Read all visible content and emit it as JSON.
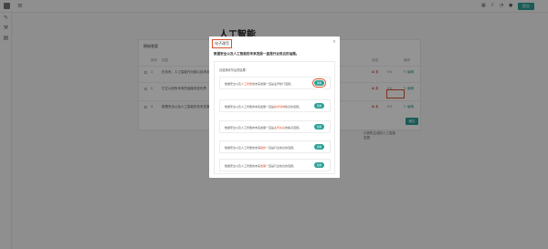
{
  "topbar": {
    "icons": [
      "grid-icon",
      "upload-icon",
      "bell-icon",
      "user-icon"
    ],
    "button_label": "提交"
  },
  "sidebar": {
    "items": [
      "edit-icon",
      "tool-icon",
      "calendar-icon"
    ]
  },
  "document": {
    "title": "人工智能",
    "section_heading": "基",
    "section_text": "蓝",
    "right_text_1": "计算机生成的人工智能",
    "right_text_2": "发展"
  },
  "panel": {
    "title": "原始答案",
    "headers": {
      "number": "序号",
      "content": "内容",
      "status": "状态",
      "action": "操作"
    },
    "rows": [
      {
        "number": "1",
        "text": "在未来，人工智能作为核心技术引领",
        "status": "⊠ 未",
        "percent": "0%",
        "action": "✎ 编辑"
      },
      {
        "number": "2",
        "text": "它正以前所未有的速度改变世界",
        "status": "⊠ 未",
        "percent": "0%",
        "action": "✎ 编辑"
      },
      {
        "number": "3",
        "text": "数据安全以及人工智能的未来发展",
        "status": "⊠ 未",
        "percent": "0%",
        "action": "✎ 编辑"
      }
    ],
    "confirm_label": "确定"
  },
  "modal": {
    "title": "句子改写",
    "question": "数据安全以及人工智能的未来发展一直是行业热议的话题。",
    "list_label": "请选择改写后的结果：",
    "cards": [
      {
        "before": "数据安全以及",
        "highlight": "人工智能",
        "after": "的未来发展一直是业界热门话题。",
        "button": "替换"
      },
      {
        "before": "数据安全以及人工智能的未来发展一直是",
        "highlight": "技术领域",
        "after": "热议的话题。",
        "button": "替换"
      },
      {
        "before": "数据安全以及人工智能的未来发展一直是",
        "highlight": "业界关注",
        "after": "的焦点话题。",
        "button": "替换"
      },
      {
        "before": "数据安全以及人工智能的未来",
        "highlight": "趋势",
        "after": "一直是行业热议的话题。",
        "button": "替换"
      },
      {
        "before": "数据安全以及人工智能的未来",
        "highlight": "发展",
        "after": "一直是行业热议的话题。",
        "button": "替换"
      }
    ]
  }
}
